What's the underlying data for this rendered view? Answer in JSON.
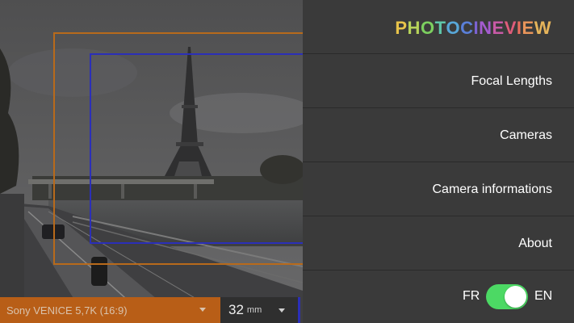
{
  "logo": {
    "letters": [
      "P",
      "H",
      "O",
      "T",
      "O",
      "C",
      "I",
      "N",
      "E",
      "V",
      "I",
      "E",
      "W"
    ],
    "colors": [
      "#e8c34a",
      "#b7d35a",
      "#7ccf5f",
      "#5fc7a9",
      "#58a7d8",
      "#5a7fd8",
      "#7b62d1",
      "#a45ccf",
      "#c75aa6",
      "#e05c7b",
      "#e86d5e",
      "#e8945a",
      "#e6b45a"
    ]
  },
  "menu": {
    "items": [
      {
        "label": "Focal Lengths"
      },
      {
        "label": "Cameras"
      },
      {
        "label": "Camera informations"
      },
      {
        "label": "About"
      }
    ],
    "language": {
      "left": "FR",
      "right": "EN",
      "selected": "EN"
    }
  },
  "camera": {
    "model": "Sony VENICE 5,7K (16:9)"
  },
  "focal": {
    "value": "32",
    "unit": "mm"
  },
  "colors": {
    "frame_primary": "#b86a1b",
    "frame_secondary": "#2b2fb8",
    "toggle_on": "#4cd964",
    "camera_bar": "#b85e17"
  }
}
